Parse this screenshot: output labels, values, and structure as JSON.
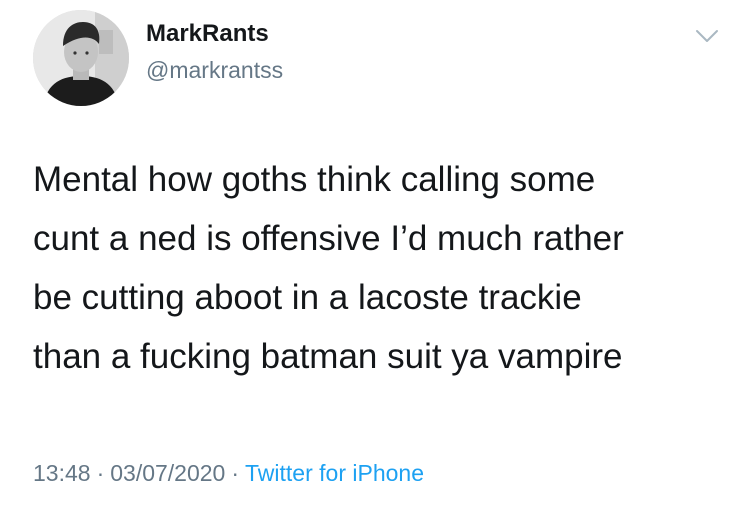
{
  "user": {
    "display_name": "MarkRants",
    "handle": "@markrantss"
  },
  "tweet": {
    "lines": [
      "Mental how goths think calling some",
      "cunt a ned is offensive I’d much rather",
      "be cutting aboot in a lacoste trackie",
      "than a fucking batman suit ya vampire"
    ],
    "time": "13:48",
    "date": "03/07/2020",
    "separator": "·",
    "source": "Twitter for iPhone"
  },
  "icons": {
    "menu": "chevron-down-icon"
  },
  "colors": {
    "text": "#14171a",
    "secondary": "#657786",
    "link": "#1da1f2"
  }
}
